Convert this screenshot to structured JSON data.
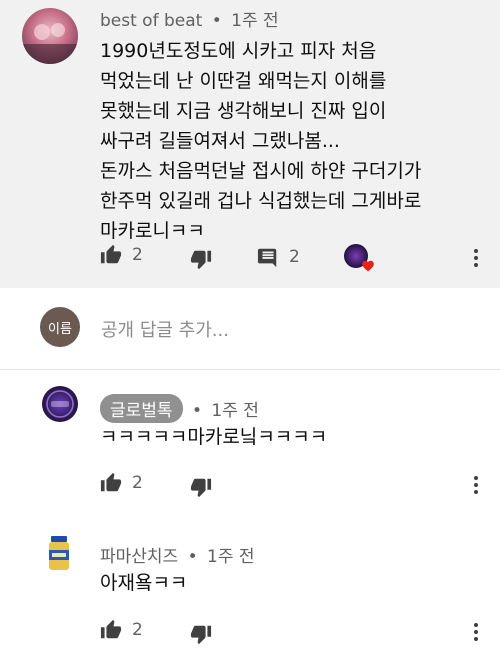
{
  "comment1": {
    "author": "best of beat",
    "separator": "•",
    "time": "1주 전",
    "lines": [
      "1990년도정도에 시카고 피자 처음",
      "먹었는데 난 이딴걸 왜먹는지 이해를",
      "못했는데 지금 생각해보니 진짜 입이",
      "싸구려 길들여져서 그랬나봄...",
      "돈까스 처음먹던날 접시에 하얀 구더기가",
      "한주먹 있길래 겁나 식겁했는데 그게바로",
      "마카로니ㅋㅋ"
    ],
    "likes": "2",
    "replies": "2"
  },
  "reply_box": {
    "avatar_label": "이름",
    "placeholder": "공개 답글 추가..."
  },
  "reply1": {
    "author": "글로벌톡",
    "separator": "•",
    "time": "1주 전",
    "text": "ㅋㅋㅋㅋㅋ마카로닠ㅋㅋㅋㅋ",
    "likes": "2"
  },
  "reply2": {
    "author": "파마산치즈",
    "separator": "•",
    "time": "1주 전",
    "text": "아재욬ㅋㅋ",
    "likes": "2"
  },
  "icons": {
    "like": "thumb-up-icon",
    "dislike": "thumb-down-icon",
    "reply": "comment-icon",
    "more": "more-vert-icon",
    "heart": "heart-icon"
  },
  "colors": {
    "main_bg": "#f1f1f1",
    "text": "#0f0f0f",
    "meta": "#606060",
    "heart": "#e62117",
    "chip": "#909090"
  }
}
